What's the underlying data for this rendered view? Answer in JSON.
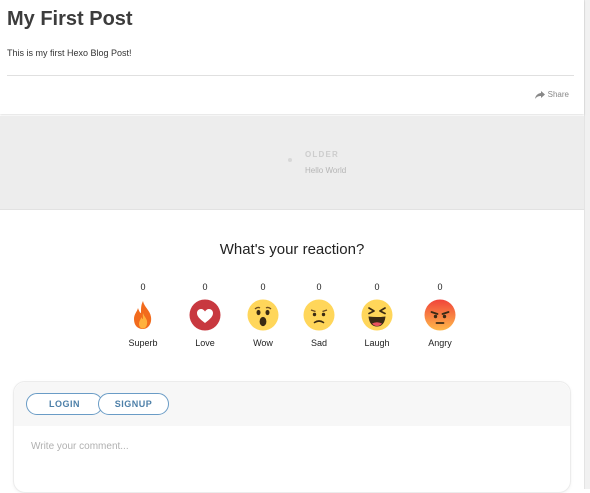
{
  "post": {
    "title": "My First Post",
    "body": "This is my first Hexo Blog Post!",
    "share_label": "Share"
  },
  "pager": {
    "older_label": "OLDER",
    "older_title": "Hello World"
  },
  "reactions": {
    "heading": "What's your reaction?",
    "items": [
      {
        "label": "Superb",
        "count": "0",
        "icon": "fire-icon"
      },
      {
        "label": "Love",
        "count": "0",
        "icon": "heart-icon"
      },
      {
        "label": "Wow",
        "count": "0",
        "icon": "wow-face-icon"
      },
      {
        "label": "Sad",
        "count": "0",
        "icon": "sad-face-icon"
      },
      {
        "label": "Laugh",
        "count": "0",
        "icon": "laugh-face-icon"
      },
      {
        "label": "Angry",
        "count": "0",
        "icon": "angry-face-icon"
      }
    ]
  },
  "comments": {
    "login_label": "LOGIN",
    "signup_label": "SIGNUP",
    "placeholder": "Write your comment..."
  },
  "colors": {
    "accent": "#4c7fa8",
    "pager_band": "#ededed"
  }
}
